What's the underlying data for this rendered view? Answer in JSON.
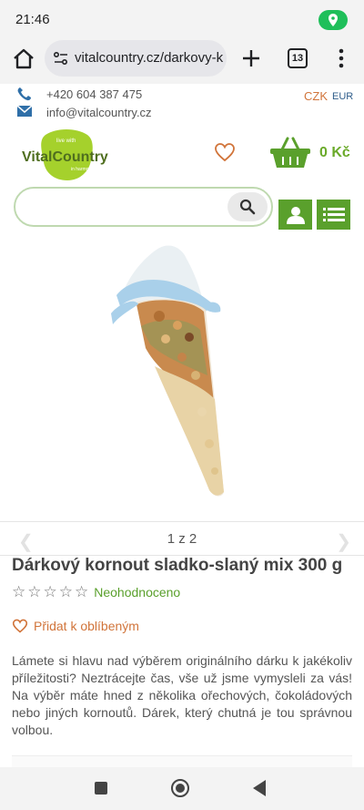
{
  "status_bar": {
    "time": "21:46",
    "location_icon": "location-pin-icon"
  },
  "browser": {
    "url": "vitalcountry.cz/darkovy-k",
    "tab_count": "13"
  },
  "contact": {
    "phone": "+420 604 387 475",
    "email": "info@vitalcountry.cz"
  },
  "currency": {
    "primary": "CZK",
    "secondary": "EUR"
  },
  "header": {
    "logo_text": "VitalCountry",
    "logo_tagline_top": "live with",
    "logo_tagline_bottom": "in harmony",
    "cart_price": "0 Kč"
  },
  "search": {
    "placeholder": ""
  },
  "gallery": {
    "pager": "1 z 2"
  },
  "product": {
    "title": "Dárkový kornout sladko-slaný mix 300 g",
    "rating_text": "Neohodnoceno",
    "wishlist_label": "Přidat k oblíbeným",
    "description": "Lámete si hlavu nad výběrem originálního dárku k jakékoliv příležitosti? Neztrácejte čas, vše už jsme vymysleli za vás! Na výběr máte hned z několika ořechových, čokoládových nebo jiných kornoutů. Dárek, který chutná je tou správnou volbou."
  },
  "colors": {
    "accent_green": "#5aa02c",
    "accent_orange": "#d1743a"
  }
}
